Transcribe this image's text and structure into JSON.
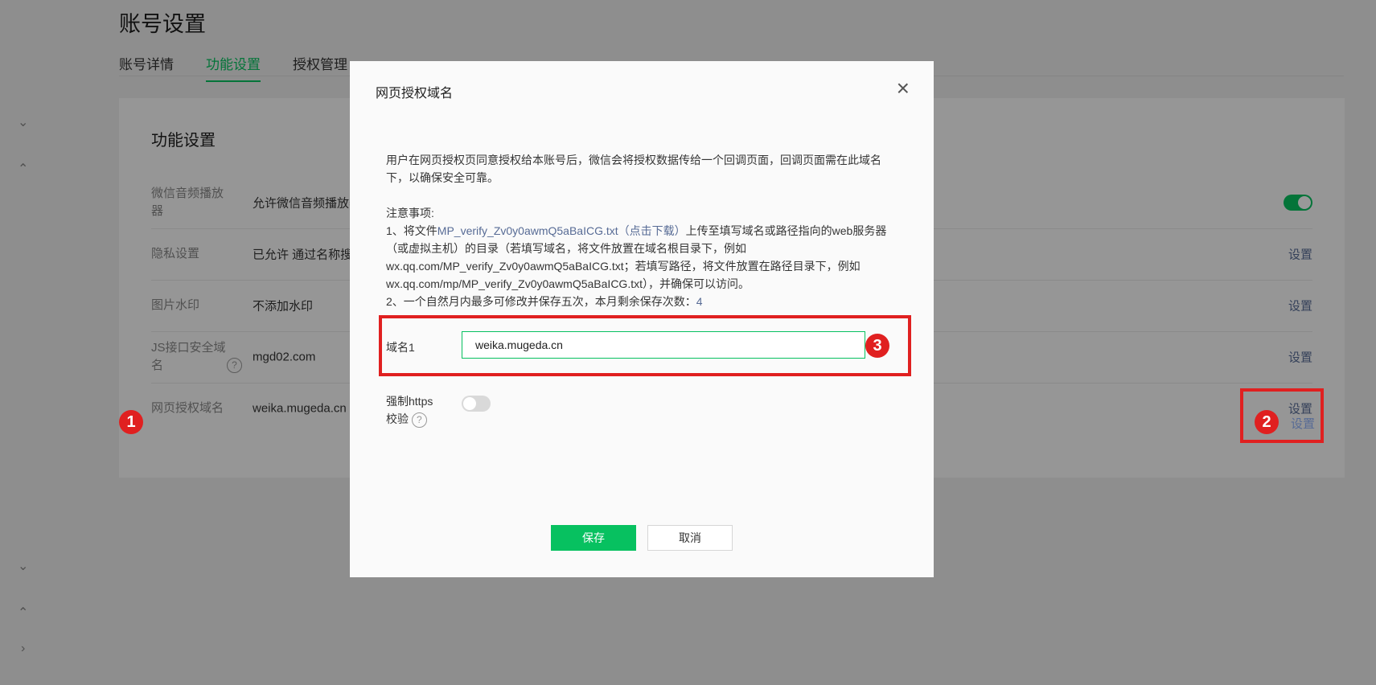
{
  "page": {
    "title": "账号设置"
  },
  "tabs": [
    {
      "label": "账号详情"
    },
    {
      "label": "功能设置"
    },
    {
      "label": "授权管理"
    }
  ],
  "sidebar": {
    "chevrons": [
      "⌄",
      "⌃",
      "⌄",
      "⌃",
      "›"
    ]
  },
  "card": {
    "title": "功能设置",
    "rows": [
      {
        "label": "微信音频播放器",
        "value": "允许微信音频播放器",
        "toggle": true
      },
      {
        "label": "隐私设置",
        "value": "已允许 通过名称搜索",
        "action": "设置"
      },
      {
        "label": "图片水印",
        "value": "不添加水印",
        "action": "设置"
      },
      {
        "label": "JS接口安全域名",
        "value": "mgd02.com",
        "action": "设置"
      },
      {
        "label": "网页授权域名",
        "value": "weika.mugeda.cn",
        "action": "设置"
      }
    ]
  },
  "modal": {
    "title": "网页授权域名",
    "close_icon": "×",
    "desc": "用户在网页授权页同意授权给本账号后，微信会将授权数据传给一个回调页面，回调页面需在此域名下，以确保安全可靠。",
    "notes_title": "注意事项:",
    "note1_prefix": "1、将文件",
    "note1_link": "MP_verify_Zv0y0awmQ5aBaICG.txt（点击下载）",
    "note1_suffix": "上传至填写域名或路径指向的web服务器（或虚拟主机）的目录（若填写域名，将文件放置在域名根目录下，例如wx.qq.com/MP_verify_Zv0y0awmQ5aBaICG.txt；若填写路径，将文件放置在路径目录下，例如wx.qq.com/mp/MP_verify_Zv0y0awmQ5aBaICG.txt），并确保可以访问。",
    "note2_prefix": "2、一个自然月内最多可修改并保存五次，本月剩余保存次数：",
    "note2_count": "4",
    "domain_label": "域名1",
    "domain_value": "weika.mugeda.cn",
    "https_label_1": "强制https",
    "https_label_2": "校验",
    "https_enabled": false,
    "save_label": "保存",
    "cancel_label": "取消"
  },
  "markers": {
    "m1": "1",
    "m2": "2",
    "m3": "3"
  },
  "colors": {
    "accent": "#07c160",
    "link": "#576b95",
    "highlight": "#e02020"
  }
}
